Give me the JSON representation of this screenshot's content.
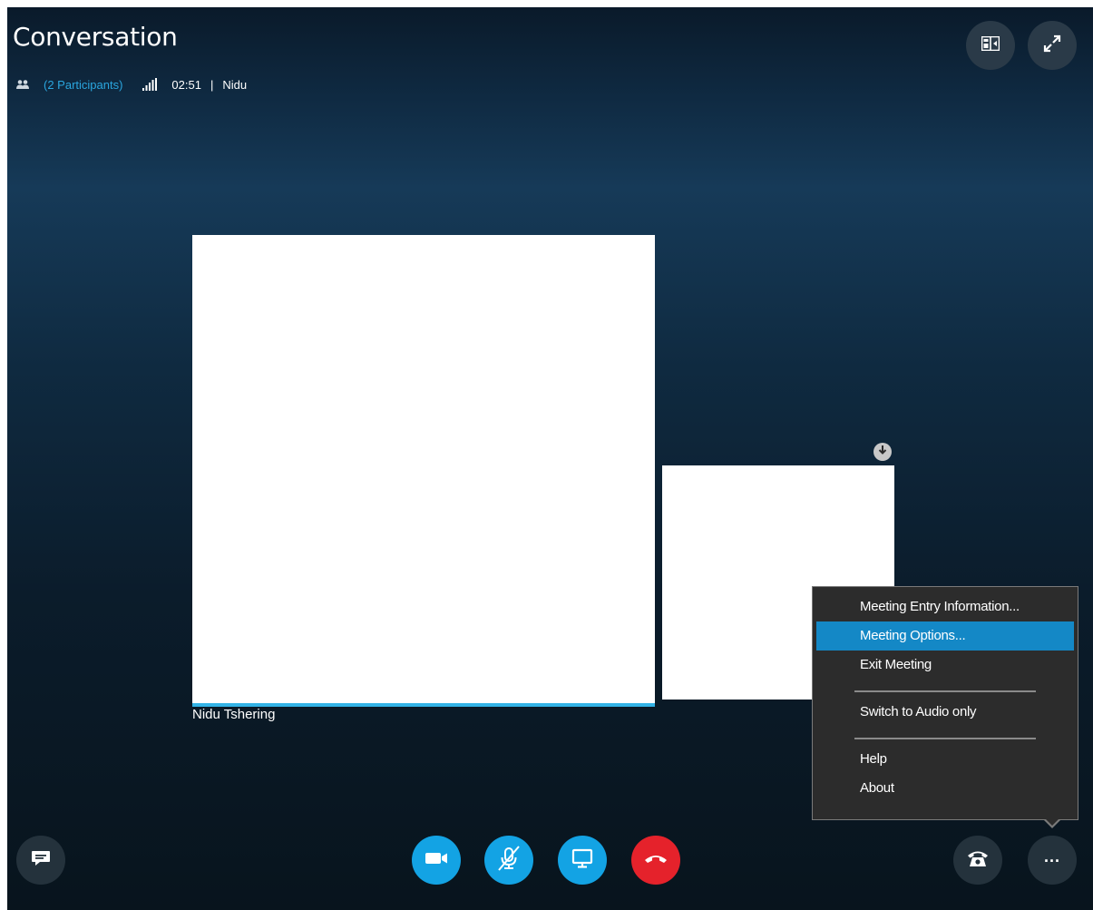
{
  "window": {
    "title": "Conversation"
  },
  "infobar": {
    "participants": "(2 Participants)",
    "elapsed": "02:51",
    "separator": "|",
    "presenter": "Nidu"
  },
  "video": {
    "main_participant_name": "Nidu Tshering"
  },
  "more_menu": {
    "items": [
      {
        "label": "Meeting Entry Information..."
      },
      {
        "label": "Meeting Options..."
      },
      {
        "label": "Exit Meeting"
      },
      {
        "label": "Switch to Audio only"
      },
      {
        "label": "Help"
      },
      {
        "label": "About"
      }
    ],
    "highlighted_index": 1
  },
  "toolbar": {
    "buttons": [
      "chat-icon",
      "video-camera-icon",
      "microphone-muted-icon",
      "present-screen-icon",
      "hang-up-icon",
      "dialpad-phone-icon",
      "more-options-icon"
    ]
  },
  "colors": {
    "accent_blue": "#13a3e4",
    "hangup_red": "#e5222b",
    "menu_highlight": "#1488c6",
    "link_blue": "#2aa6df"
  }
}
